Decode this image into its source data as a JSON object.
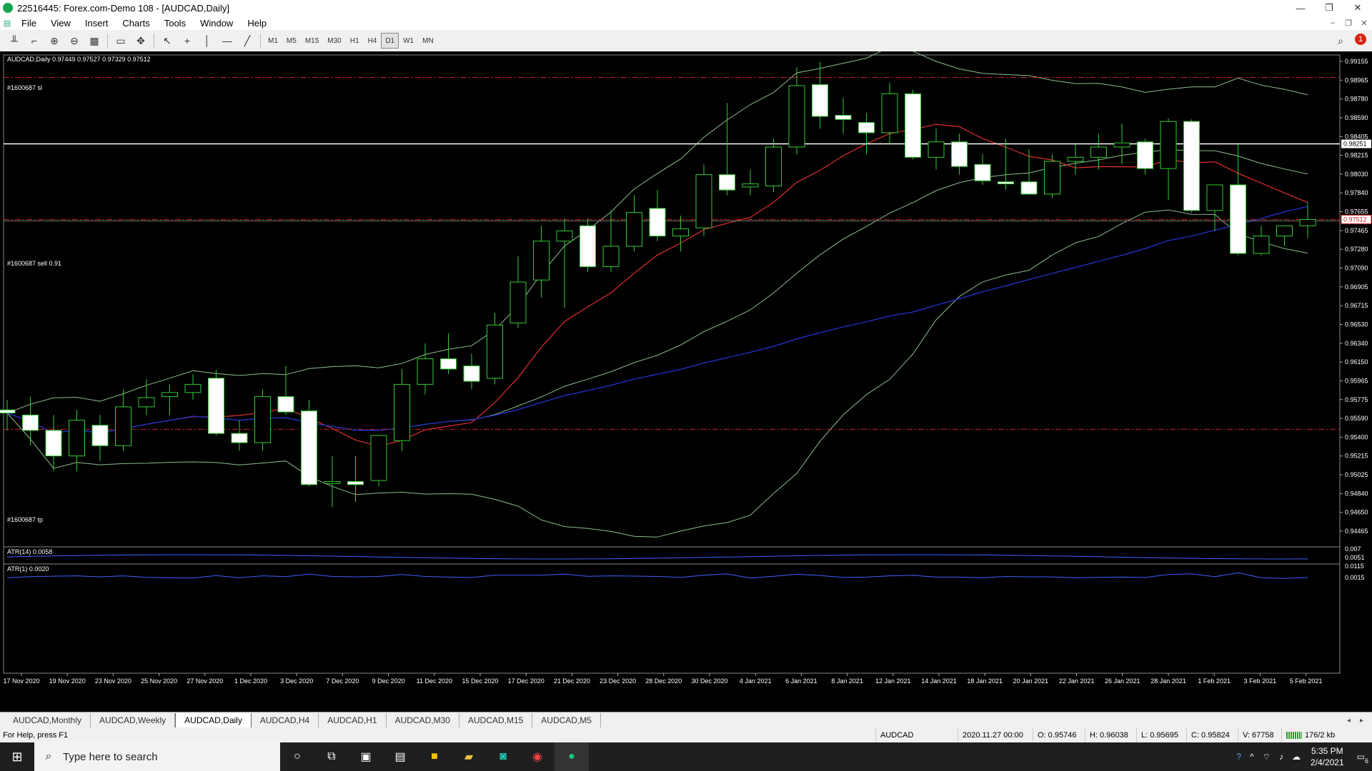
{
  "window": {
    "title": "22516445: Forex.com-Demo 108 - [AUDCAD,Daily]",
    "controls": [
      "—",
      "❐",
      "✕"
    ]
  },
  "menu": {
    "items": [
      "File",
      "View",
      "Insert",
      "Charts",
      "Tools",
      "Window",
      "Help"
    ]
  },
  "toolbar": {
    "timeframes": [
      "M1",
      "M5",
      "M15",
      "M30",
      "H1",
      "H4",
      "D1",
      "W1",
      "MN"
    ],
    "active_timeframe": "D1",
    "alert_count": "1"
  },
  "chart": {
    "header": "AUDCAD,Daily  0.97449 0.97527 0.97329 0.97512",
    "sl_label": "#1600687 sl",
    "sell_label": "#1600687 sell 0.91",
    "tp_label": "#1600687 tp",
    "hline_price": "0.98251",
    "current_price": "0.97512",
    "atr14_label": "ATR(14) 0.0058",
    "atr1_label": "ATR(1) 0.0020",
    "atr14_scale": [
      "0.007",
      "0.0051"
    ],
    "atr1_scale": [
      "0.0115",
      "0.0015"
    ],
    "price_ticks": [
      "0.99155",
      "0.98965",
      "0.98780",
      "0.98590",
      "0.98405",
      "0.98215",
      "0.98030",
      "0.97840",
      "0.97655",
      "0.97465",
      "0.97280",
      "0.97090",
      "0.96905",
      "0.96715",
      "0.96530",
      "0.96340",
      "0.96150",
      "0.95965",
      "0.95775",
      "0.95590",
      "0.95400",
      "0.95215",
      "0.95025",
      "0.94840",
      "0.94650",
      "0.94465"
    ],
    "date_ticks": [
      "17 Nov 2020",
      "19 Nov 2020",
      "23 Nov 2020",
      "25 Nov 2020",
      "27 Nov 2020",
      "1 Dec 2020",
      "3 Dec 2020",
      "7 Dec 2020",
      "9 Dec 2020",
      "11 Dec 2020",
      "15 Dec 2020",
      "17 Dec 2020",
      "21 Dec 2020",
      "23 Dec 2020",
      "28 Dec 2020",
      "30 Dec 2020",
      "4 Jan 2021",
      "6 Jan 2021",
      "8 Jan 2021",
      "12 Jan 2021",
      "14 Jan 2021",
      "18 Jan 2021",
      "20 Jan 2021",
      "22 Jan 2021",
      "26 Jan 2021",
      "28 Jan 2021",
      "1 Feb 2021",
      "3 Feb 2021",
      "5 Feb 2021"
    ]
  },
  "chart_data": {
    "type": "candlestick",
    "symbol": "AUDCAD",
    "timeframe": "Daily",
    "ylim": [
      0.94465,
      0.99155
    ],
    "levels": {
      "stop_loss": 0.989,
      "horizontal_line": 0.98251,
      "sell_entry": 0.97512,
      "take_profit": 0.9546
    },
    "candles": [
      {
        "date": "16 Nov 2020",
        "o": 0.9565,
        "h": 0.9575,
        "l": 0.9545,
        "c": 0.9562
      },
      {
        "date": "17 Nov 2020",
        "o": 0.956,
        "h": 0.9578,
        "l": 0.953,
        "c": 0.9545
      },
      {
        "date": "18 Nov 2020",
        "o": 0.9545,
        "h": 0.956,
        "l": 0.9505,
        "c": 0.952
      },
      {
        "date": "19 Nov 2020",
        "o": 0.952,
        "h": 0.9565,
        "l": 0.9505,
        "c": 0.9555
      },
      {
        "date": "20 Nov 2020",
        "o": 0.955,
        "h": 0.956,
        "l": 0.9515,
        "c": 0.953
      },
      {
        "date": "23 Nov 2020",
        "o": 0.953,
        "h": 0.9585,
        "l": 0.9525,
        "c": 0.9568
      },
      {
        "date": "24 Nov 2020",
        "o": 0.9568,
        "h": 0.9595,
        "l": 0.956,
        "c": 0.9577
      },
      {
        "date": "25 Nov 2020",
        "o": 0.9578,
        "h": 0.959,
        "l": 0.956,
        "c": 0.9582
      },
      {
        "date": "26 Nov 2020",
        "o": 0.9582,
        "h": 0.96,
        "l": 0.9575,
        "c": 0.959
      },
      {
        "date": "27 Nov 2020",
        "o": 0.9596,
        "h": 0.9604,
        "l": 0.954,
        "c": 0.9542
      },
      {
        "date": "30 Nov 2020",
        "o": 0.9542,
        "h": 0.9555,
        "l": 0.9525,
        "c": 0.9533
      },
      {
        "date": "1 Dec 2020",
        "o": 0.9533,
        "h": 0.9585,
        "l": 0.9525,
        "c": 0.9578
      },
      {
        "date": "2 Dec 2020",
        "o": 0.9578,
        "h": 0.9608,
        "l": 0.956,
        "c": 0.9563
      },
      {
        "date": "3 Dec 2020",
        "o": 0.9564,
        "h": 0.9575,
        "l": 0.949,
        "c": 0.9492
      },
      {
        "date": "4 Dec 2020",
        "o": 0.9493,
        "h": 0.952,
        "l": 0.947,
        "c": 0.9495
      },
      {
        "date": "7 Dec 2020",
        "o": 0.9495,
        "h": 0.952,
        "l": 0.9475,
        "c": 0.9492
      },
      {
        "date": "8 Dec 2020",
        "o": 0.9496,
        "h": 0.954,
        "l": 0.949,
        "c": 0.954
      },
      {
        "date": "9 Dec 2020",
        "o": 0.9535,
        "h": 0.9605,
        "l": 0.9525,
        "c": 0.959
      },
      {
        "date": "10 Dec 2020",
        "o": 0.959,
        "h": 0.963,
        "l": 0.958,
        "c": 0.9615
      },
      {
        "date": "11 Dec 2020",
        "o": 0.9615,
        "h": 0.964,
        "l": 0.96,
        "c": 0.9605
      },
      {
        "date": "14 Dec 2020",
        "o": 0.9608,
        "h": 0.962,
        "l": 0.9585,
        "c": 0.9593
      },
      {
        "date": "15 Dec 2020",
        "o": 0.9596,
        "h": 0.966,
        "l": 0.959,
        "c": 0.9648
      },
      {
        "date": "16 Dec 2020",
        "o": 0.965,
        "h": 0.9715,
        "l": 0.9645,
        "c": 0.969
      },
      {
        "date": "17 Dec 2020",
        "o": 0.9692,
        "h": 0.9745,
        "l": 0.9675,
        "c": 0.973
      },
      {
        "date": "18 Dec 2020",
        "o": 0.973,
        "h": 0.9752,
        "l": 0.9665,
        "c": 0.974
      },
      {
        "date": "21 Dec 2020",
        "o": 0.9745,
        "h": 0.9752,
        "l": 0.97,
        "c": 0.9705
      },
      {
        "date": "22 Dec 2020",
        "o": 0.9705,
        "h": 0.976,
        "l": 0.97,
        "c": 0.9725
      },
      {
        "date": "23 Dec 2020",
        "o": 0.9725,
        "h": 0.9775,
        "l": 0.972,
        "c": 0.9758
      },
      {
        "date": "24 Dec 2020",
        "o": 0.9762,
        "h": 0.978,
        "l": 0.973,
        "c": 0.9735
      },
      {
        "date": "28 Dec 2020",
        "o": 0.9735,
        "h": 0.9755,
        "l": 0.972,
        "c": 0.9742
      },
      {
        "date": "29 Dec 2020",
        "o": 0.9743,
        "h": 0.9805,
        "l": 0.9735,
        "c": 0.9795
      },
      {
        "date": "30 Dec 2020",
        "o": 0.9795,
        "h": 0.9865,
        "l": 0.9775,
        "c": 0.978
      },
      {
        "date": "31 Dec 2020",
        "o": 0.9783,
        "h": 0.98,
        "l": 0.9775,
        "c": 0.9786
      },
      {
        "date": "4 Jan 2021",
        "o": 0.9784,
        "h": 0.983,
        "l": 0.9778,
        "c": 0.9822
      },
      {
        "date": "5 Jan 2021",
        "o": 0.9822,
        "h": 0.99,
        "l": 0.9815,
        "c": 0.9882
      },
      {
        "date": "6 Jan 2021",
        "o": 0.9883,
        "h": 0.9905,
        "l": 0.984,
        "c": 0.9852
      },
      {
        "date": "7 Jan 2021",
        "o": 0.9853,
        "h": 0.987,
        "l": 0.9835,
        "c": 0.9849
      },
      {
        "date": "8 Jan 2021",
        "o": 0.9846,
        "h": 0.9855,
        "l": 0.9815,
        "c": 0.9836
      },
      {
        "date": "11 Jan 2021",
        "o": 0.9836,
        "h": 0.9885,
        "l": 0.9825,
        "c": 0.9874
      },
      {
        "date": "12 Jan 2021",
        "o": 0.9874,
        "h": 0.9878,
        "l": 0.981,
        "c": 0.9812
      },
      {
        "date": "13 Jan 2021",
        "o": 0.9812,
        "h": 0.984,
        "l": 0.98,
        "c": 0.9827
      },
      {
        "date": "14 Jan 2021",
        "o": 0.9827,
        "h": 0.9835,
        "l": 0.9795,
        "c": 0.9803
      },
      {
        "date": "15 Jan 2021",
        "o": 0.9805,
        "h": 0.9815,
        "l": 0.9785,
        "c": 0.9789
      },
      {
        "date": "18 Jan 2021",
        "o": 0.9788,
        "h": 0.983,
        "l": 0.978,
        "c": 0.9786
      },
      {
        "date": "19 Jan 2021",
        "o": 0.9788,
        "h": 0.982,
        "l": 0.9775,
        "c": 0.9776
      },
      {
        "date": "20 Jan 2021",
        "o": 0.9776,
        "h": 0.9815,
        "l": 0.9772,
        "c": 0.9808
      },
      {
        "date": "21 Jan 2021",
        "o": 0.9808,
        "h": 0.9825,
        "l": 0.9795,
        "c": 0.9812
      },
      {
        "date": "22 Jan 2021",
        "o": 0.9812,
        "h": 0.9835,
        "l": 0.98,
        "c": 0.9822
      },
      {
        "date": "25 Jan 2021",
        "o": 0.9822,
        "h": 0.9845,
        "l": 0.9805,
        "c": 0.9826
      },
      {
        "date": "26 Jan 2021",
        "o": 0.9827,
        "h": 0.983,
        "l": 0.9795,
        "c": 0.9801
      },
      {
        "date": "27 Jan 2021",
        "o": 0.9801,
        "h": 0.985,
        "l": 0.977,
        "c": 0.9847
      },
      {
        "date": "28 Jan 2021",
        "o": 0.9847,
        "h": 0.9849,
        "l": 0.9758,
        "c": 0.976
      },
      {
        "date": "29 Jan 2021",
        "o": 0.976,
        "h": 0.9785,
        "l": 0.974,
        "c": 0.9785
      },
      {
        "date": "1 Feb 2021",
        "o": 0.9785,
        "h": 0.9825,
        "l": 0.9716,
        "c": 0.9718
      },
      {
        "date": "2 Feb 2021",
        "o": 0.9718,
        "h": 0.9745,
        "l": 0.9716,
        "c": 0.9735
      },
      {
        "date": "3 Feb 2021",
        "o": 0.9735,
        "h": 0.9745,
        "l": 0.9725,
        "c": 0.9745
      },
      {
        "date": "4 Feb 2021",
        "o": 0.9745,
        "h": 0.9768,
        "l": 0.9733,
        "c": 0.97512
      }
    ]
  },
  "bottom_tabs": [
    "AUDCAD,Monthly",
    "AUDCAD,Weekly",
    "AUDCAD,Daily",
    "AUDCAD,H4",
    "AUDCAD,H1",
    "AUDCAD,M30",
    "AUDCAD,M15",
    "AUDCAD,M5"
  ],
  "active_tab": "AUDCAD,Daily",
  "status": {
    "help": "For Help, press F1",
    "symbol": "AUDCAD",
    "datetime": "2020.11.27 00:00",
    "open": "O: 0.95746",
    "high": "H: 0.96038",
    "low": "L: 0.95695",
    "close": "C: 0.95824",
    "volume": "V: 67758",
    "traffic": "176/2 kb"
  },
  "taskbar": {
    "search_placeholder": "Type here to search",
    "time": "5:35 PM",
    "date": "2/4/2021",
    "notifications": "6"
  },
  "colors": {
    "bull_body": "#000000",
    "bear_body": "#ffffff",
    "candle_outline": "#33cc33",
    "ma_red": "#e03030",
    "ma_blue": "#2030c0",
    "bands": "#8fbc8f",
    "trade_line": "#cc2222",
    "hline": "#ffffff"
  }
}
